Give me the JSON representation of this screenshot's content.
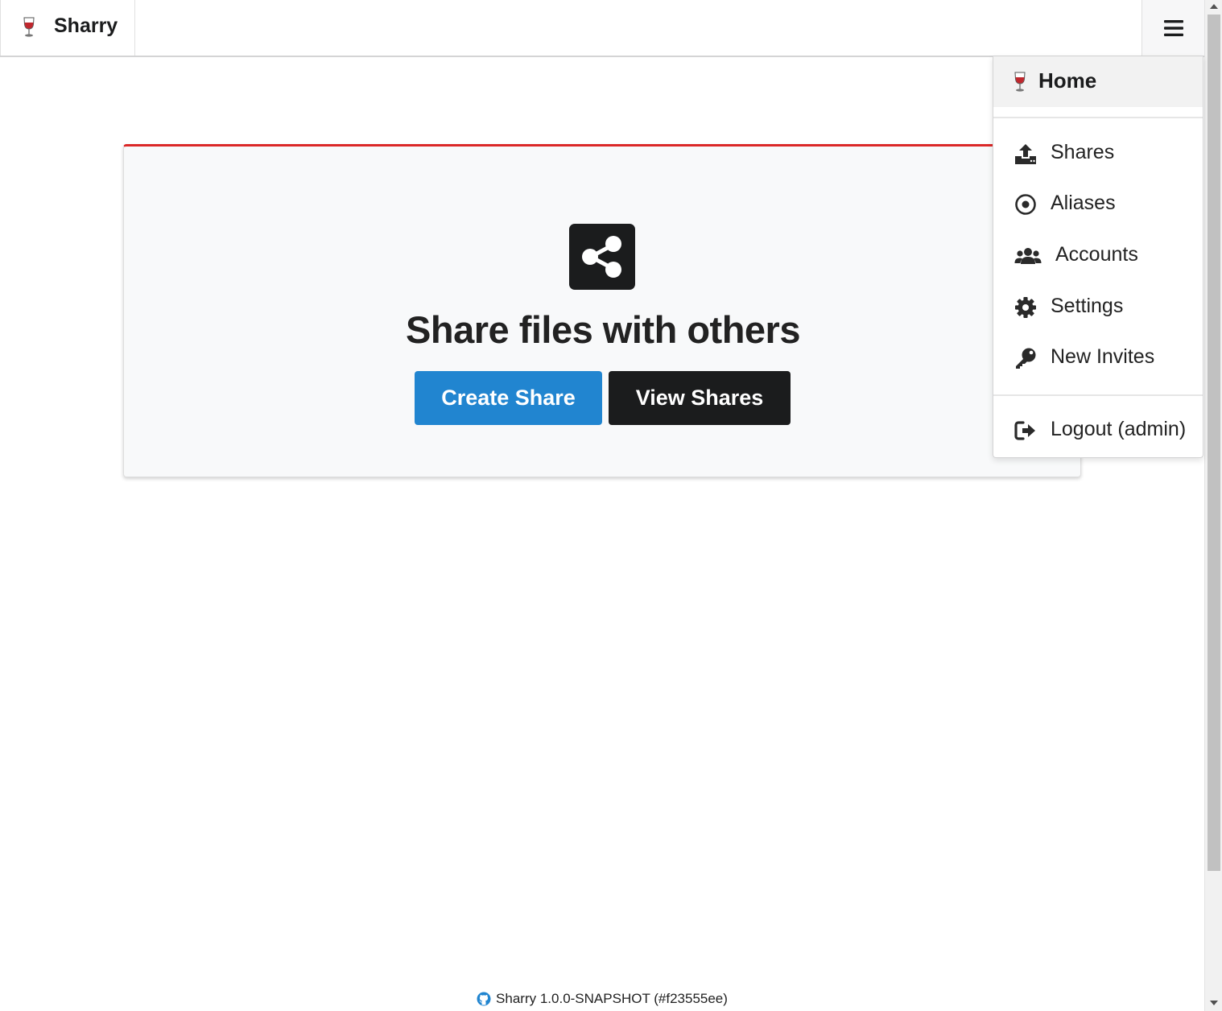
{
  "app": {
    "name": "Sharry"
  },
  "hero": {
    "headline": "Share files with others",
    "create_label": "Create Share",
    "view_label": "View Shares"
  },
  "menu": {
    "home_label": "Home",
    "items": [
      {
        "label": "Shares",
        "icon": "upload-icon"
      },
      {
        "label": "Aliases",
        "icon": "dot-circle-icon"
      },
      {
        "label": "Accounts",
        "icon": "users-icon"
      },
      {
        "label": "Settings",
        "icon": "gear-icon"
      },
      {
        "label": "New Invites",
        "icon": "key-icon"
      }
    ],
    "logout_label": "Logout (admin)",
    "logout_icon": "sign-out-icon"
  },
  "footer": {
    "version": "Sharry 1.0.0-SNAPSHOT (#f23555ee)",
    "icon": "github-icon"
  },
  "colors": {
    "primary": "#2185d0",
    "dark": "#1b1c1d",
    "accent_red": "#db2828",
    "card_bg": "#f8f9fa"
  }
}
